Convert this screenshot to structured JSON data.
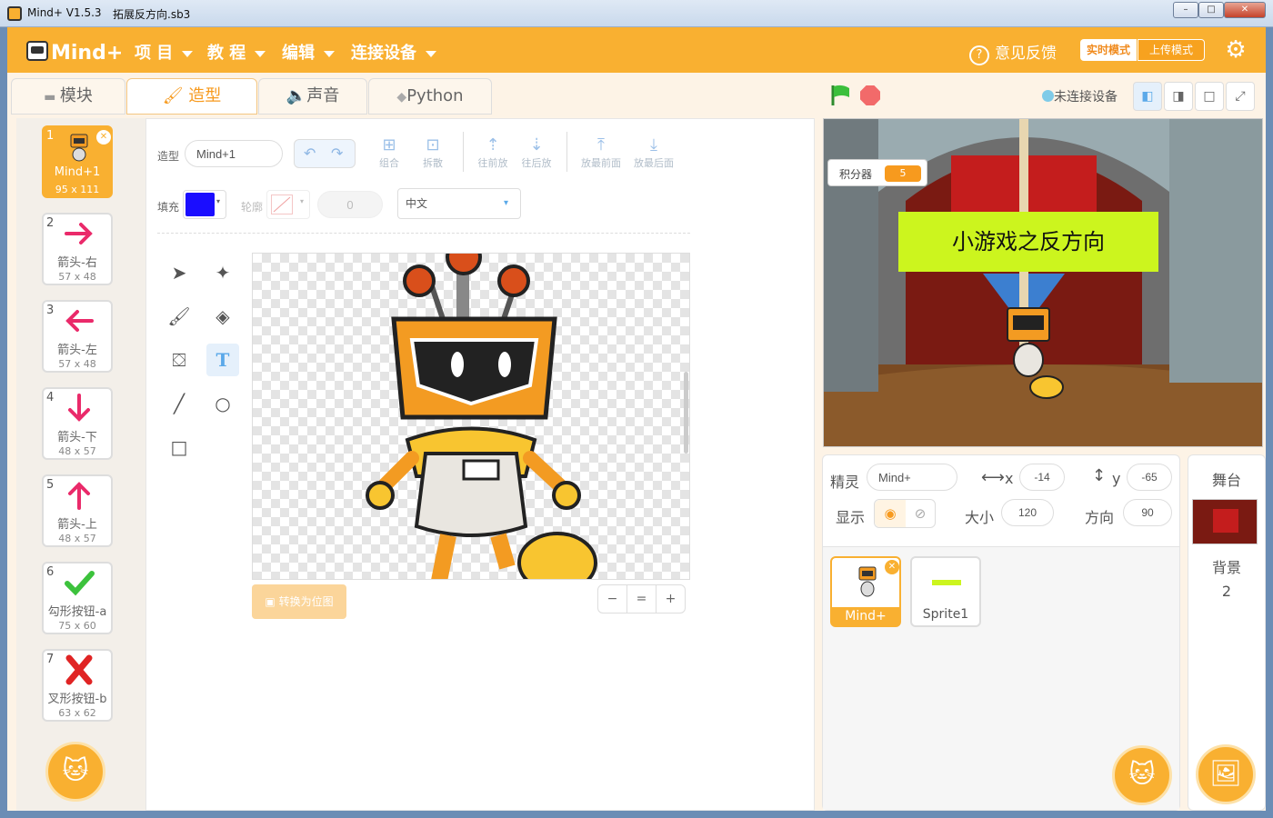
{
  "window": {
    "app_title": "Mind+ V1.5.3",
    "file_name": "拓展反方向.sb3",
    "min": "–",
    "max": "□",
    "close": "✕"
  },
  "menu": {
    "items": [
      "项 目",
      "教 程",
      "编辑",
      "连接设备"
    ],
    "feedback": "意见反馈",
    "mode_realtime": "实时模式",
    "mode_upload": "上传模式"
  },
  "tabs": [
    "模块",
    "造型",
    "声音",
    "Python"
  ],
  "costumes": [
    {
      "num": "1",
      "name": "Mind+1",
      "size": "95 x 111"
    },
    {
      "num": "2",
      "name": "箭头-右",
      "size": "57 x 48"
    },
    {
      "num": "3",
      "name": "箭头-左",
      "size": "57 x 48"
    },
    {
      "num": "4",
      "name": "箭头-下",
      "size": "48 x 57"
    },
    {
      "num": "5",
      "name": "箭头-上",
      "size": "48 x 57"
    },
    {
      "num": "6",
      "name": "勾形按钮-a",
      "size": "75 x 60"
    },
    {
      "num": "7",
      "name": "叉形按钮-b",
      "size": "63 x 62"
    }
  ],
  "editor": {
    "costume_label": "造型",
    "costume_name": "Mind+1",
    "group": "组合",
    "ungroup": "拆散",
    "forward": "往前放",
    "backward": "往后放",
    "front": "放最前面",
    "back": "放最后面",
    "fill_label": "填充",
    "outline_label": "轮廓",
    "outline_value": "0",
    "font": "中文",
    "fill_color": "#1a0dff",
    "convert_bitmap": "转换为位图",
    "zoom_out": "−",
    "zoom_reset": "=",
    "zoom_in": "+"
  },
  "stage": {
    "disconnected": "未连接设备",
    "counter_label": "积分器",
    "counter_value": "5",
    "banner": "小游戏之反方向"
  },
  "sprite_info": {
    "sprite_label": "精灵",
    "sprite_name": "Mind+",
    "x_label": "x",
    "x": "-14",
    "y_label": "y",
    "y": "-65",
    "show_label": "显示",
    "size_label": "大小",
    "size": "120",
    "direction_label": "方向",
    "direction": "90"
  },
  "sprites": [
    {
      "name": "Mind+"
    },
    {
      "name": "Sprite1"
    }
  ],
  "stage_panel": {
    "title": "舞台",
    "backdrop_label": "背景",
    "backdrop_count": "2"
  }
}
